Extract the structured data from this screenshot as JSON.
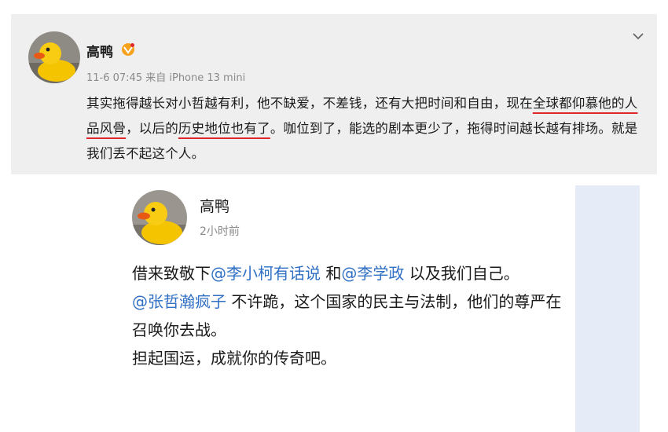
{
  "post1": {
    "author": "高鸭",
    "meta": "11-6 07:45 来自 iPhone 13 mini",
    "body": {
      "s1": "其实拖得越长对小哲越有利，他不缺爱，不差钱，还有大把时间和自由，现在",
      "h1": "全球都仰慕他的人品风骨",
      "s2": "，以后的",
      "h2": "历史地位也有了",
      "s3": "。咖位到了，能选的剧本更少了，拖得时间越长越有排场。就是我们丢不起这个人。"
    }
  },
  "post2": {
    "author": "高鸭",
    "meta": "2小时前",
    "body": {
      "p1_a": "借来致敬下",
      "mention1": "@李小柯有话说",
      "p1_b": " 和",
      "mention2": "@李学政",
      "p1_c": " 以及我们自己。",
      "mention3": "@张哲瀚疯子",
      "p2": " 不许跪，这个国家的民主与法制，他们的尊严在召唤你去战。",
      "p3": "担起国运，成就你的传奇吧。"
    }
  },
  "icons": {
    "avatar": "rubber-duck-avatar",
    "vip": "vip-badge-icon",
    "menu": "chevron-down-icon"
  },
  "colors": {
    "underline": "#e0262b",
    "mention": "#2f6fc4",
    "meta": "#8a8a8a"
  }
}
